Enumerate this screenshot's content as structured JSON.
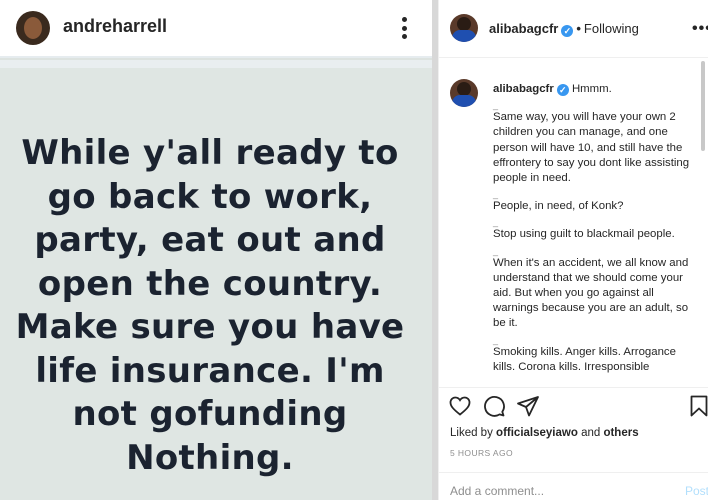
{
  "embedded_post": {
    "username": "andreharrell",
    "quote_lines": [
      "While y'all ready to",
      "go back to work,",
      "party, eat out and",
      "open the country.",
      "Make sure you have",
      "life insurance. I'm",
      "not gofunding",
      "Nothing."
    ]
  },
  "header": {
    "username": "alibabagcfr",
    "verified_glyph": "✓",
    "separator": "•",
    "follow_status": "Following",
    "more_glyph": "•••"
  },
  "caption": {
    "username": "alibabagcfr",
    "first_line": "Hmmm.",
    "paragraphs": [
      "Same way, you will have your own 2 children you can manage, and one person will have 10, and still have the effrontery to say you dont like assisting people in need.",
      "People, in need, of Konk?",
      "Stop using guilt to blackmail people.",
      "When it's an accident, we all know and understand that we should come your aid. But when you go against all warnings because you are an adult, so be it.",
      "Smoking kills. Anger kills. Arrogance kills. Corona kills. Irresponsible"
    ],
    "dash": "_"
  },
  "actions": {
    "icons": [
      "heart-icon",
      "comment-icon",
      "share-icon",
      "bookmark-icon"
    ]
  },
  "likes": {
    "prefix": "Liked by",
    "user": "officialseyiawo",
    "and": "and",
    "others": "others"
  },
  "timestamp": "5 HOURS AGO",
  "comment": {
    "placeholder": "Add a comment...",
    "post_label": "Post"
  }
}
